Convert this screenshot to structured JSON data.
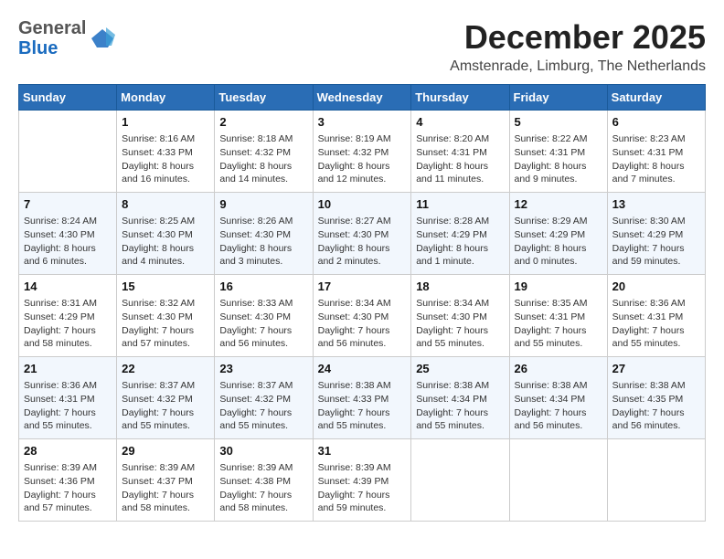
{
  "logo": {
    "general": "General",
    "blue": "Blue"
  },
  "title": "December 2025",
  "location": "Amstenrade, Limburg, The Netherlands",
  "days_of_week": [
    "Sunday",
    "Monday",
    "Tuesday",
    "Wednesday",
    "Thursday",
    "Friday",
    "Saturday"
  ],
  "weeks": [
    [
      {
        "day": "",
        "info": ""
      },
      {
        "day": "1",
        "info": "Sunrise: 8:16 AM\nSunset: 4:33 PM\nDaylight: 8 hours and 16 minutes."
      },
      {
        "day": "2",
        "info": "Sunrise: 8:18 AM\nSunset: 4:32 PM\nDaylight: 8 hours and 14 minutes."
      },
      {
        "day": "3",
        "info": "Sunrise: 8:19 AM\nSunset: 4:32 PM\nDaylight: 8 hours and 12 minutes."
      },
      {
        "day": "4",
        "info": "Sunrise: 8:20 AM\nSunset: 4:31 PM\nDaylight: 8 hours and 11 minutes."
      },
      {
        "day": "5",
        "info": "Sunrise: 8:22 AM\nSunset: 4:31 PM\nDaylight: 8 hours and 9 minutes."
      },
      {
        "day": "6",
        "info": "Sunrise: 8:23 AM\nSunset: 4:31 PM\nDaylight: 8 hours and 7 minutes."
      }
    ],
    [
      {
        "day": "7",
        "info": "Sunrise: 8:24 AM\nSunset: 4:30 PM\nDaylight: 8 hours and 6 minutes."
      },
      {
        "day": "8",
        "info": "Sunrise: 8:25 AM\nSunset: 4:30 PM\nDaylight: 8 hours and 4 minutes."
      },
      {
        "day": "9",
        "info": "Sunrise: 8:26 AM\nSunset: 4:30 PM\nDaylight: 8 hours and 3 minutes."
      },
      {
        "day": "10",
        "info": "Sunrise: 8:27 AM\nSunset: 4:30 PM\nDaylight: 8 hours and 2 minutes."
      },
      {
        "day": "11",
        "info": "Sunrise: 8:28 AM\nSunset: 4:29 PM\nDaylight: 8 hours and 1 minute."
      },
      {
        "day": "12",
        "info": "Sunrise: 8:29 AM\nSunset: 4:29 PM\nDaylight: 8 hours and 0 minutes."
      },
      {
        "day": "13",
        "info": "Sunrise: 8:30 AM\nSunset: 4:29 PM\nDaylight: 7 hours and 59 minutes."
      }
    ],
    [
      {
        "day": "14",
        "info": "Sunrise: 8:31 AM\nSunset: 4:29 PM\nDaylight: 7 hours and 58 minutes."
      },
      {
        "day": "15",
        "info": "Sunrise: 8:32 AM\nSunset: 4:30 PM\nDaylight: 7 hours and 57 minutes."
      },
      {
        "day": "16",
        "info": "Sunrise: 8:33 AM\nSunset: 4:30 PM\nDaylight: 7 hours and 56 minutes."
      },
      {
        "day": "17",
        "info": "Sunrise: 8:34 AM\nSunset: 4:30 PM\nDaylight: 7 hours and 56 minutes."
      },
      {
        "day": "18",
        "info": "Sunrise: 8:34 AM\nSunset: 4:30 PM\nDaylight: 7 hours and 55 minutes."
      },
      {
        "day": "19",
        "info": "Sunrise: 8:35 AM\nSunset: 4:31 PM\nDaylight: 7 hours and 55 minutes."
      },
      {
        "day": "20",
        "info": "Sunrise: 8:36 AM\nSunset: 4:31 PM\nDaylight: 7 hours and 55 minutes."
      }
    ],
    [
      {
        "day": "21",
        "info": "Sunrise: 8:36 AM\nSunset: 4:31 PM\nDaylight: 7 hours and 55 minutes."
      },
      {
        "day": "22",
        "info": "Sunrise: 8:37 AM\nSunset: 4:32 PM\nDaylight: 7 hours and 55 minutes."
      },
      {
        "day": "23",
        "info": "Sunrise: 8:37 AM\nSunset: 4:32 PM\nDaylight: 7 hours and 55 minutes."
      },
      {
        "day": "24",
        "info": "Sunrise: 8:38 AM\nSunset: 4:33 PM\nDaylight: 7 hours and 55 minutes."
      },
      {
        "day": "25",
        "info": "Sunrise: 8:38 AM\nSunset: 4:34 PM\nDaylight: 7 hours and 55 minutes."
      },
      {
        "day": "26",
        "info": "Sunrise: 8:38 AM\nSunset: 4:34 PM\nDaylight: 7 hours and 56 minutes."
      },
      {
        "day": "27",
        "info": "Sunrise: 8:38 AM\nSunset: 4:35 PM\nDaylight: 7 hours and 56 minutes."
      }
    ],
    [
      {
        "day": "28",
        "info": "Sunrise: 8:39 AM\nSunset: 4:36 PM\nDaylight: 7 hours and 57 minutes."
      },
      {
        "day": "29",
        "info": "Sunrise: 8:39 AM\nSunset: 4:37 PM\nDaylight: 7 hours and 58 minutes."
      },
      {
        "day": "30",
        "info": "Sunrise: 8:39 AM\nSunset: 4:38 PM\nDaylight: 7 hours and 58 minutes."
      },
      {
        "day": "31",
        "info": "Sunrise: 8:39 AM\nSunset: 4:39 PM\nDaylight: 7 hours and 59 minutes."
      },
      {
        "day": "",
        "info": ""
      },
      {
        "day": "",
        "info": ""
      },
      {
        "day": "",
        "info": ""
      }
    ]
  ]
}
